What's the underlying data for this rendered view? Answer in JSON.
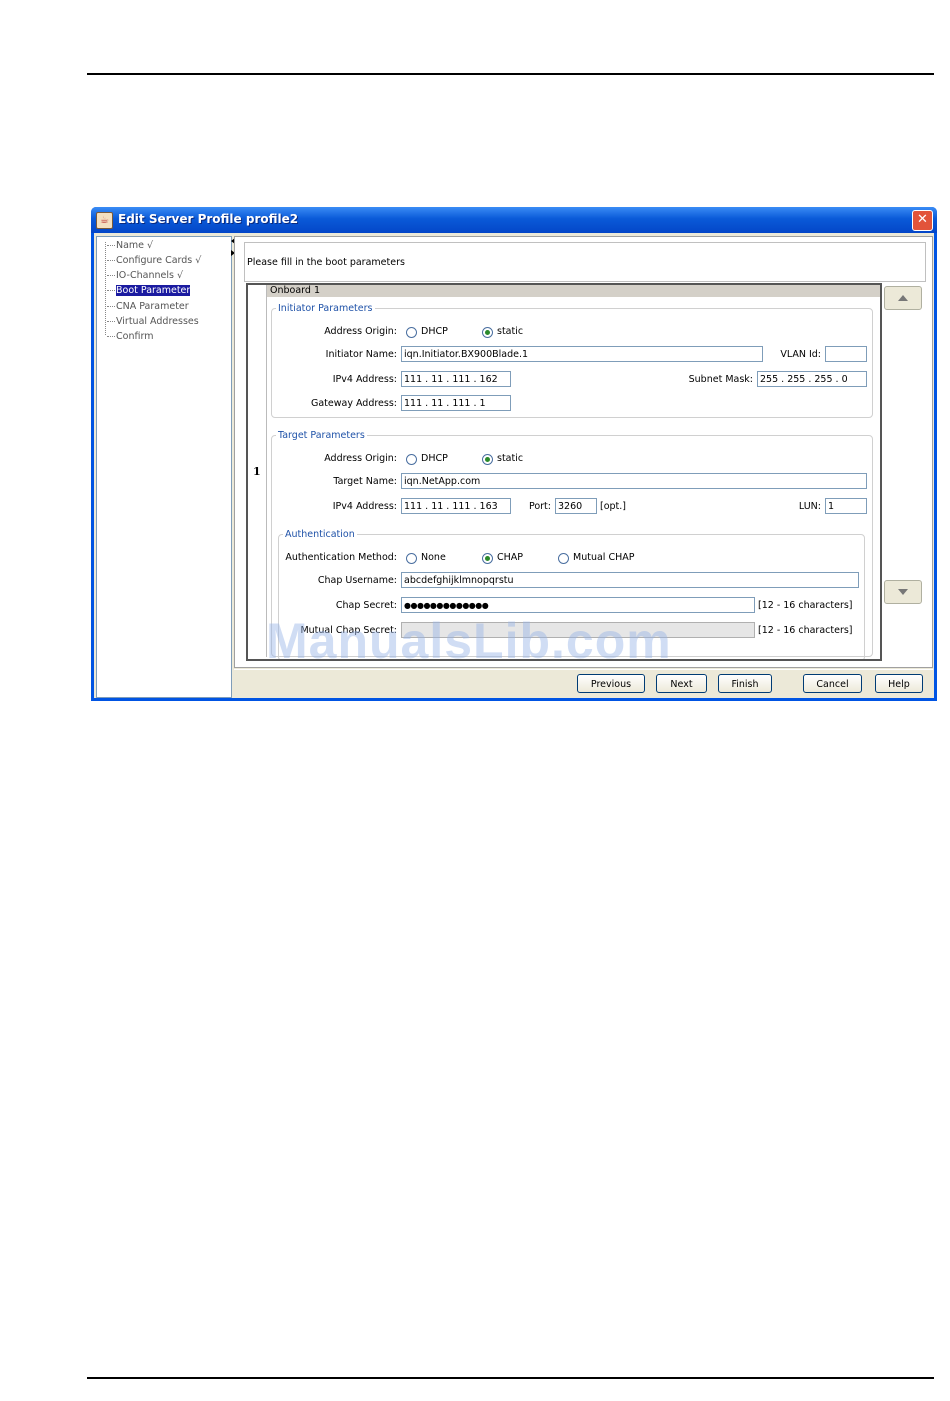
{
  "window": {
    "title": "Edit Server Profile profile2",
    "close_glyph": "✕",
    "title_icon": "java-icon"
  },
  "tree": {
    "items": [
      {
        "label": "Name √"
      },
      {
        "label": "Configure Cards √"
      },
      {
        "label": "IO-Channels √"
      },
      {
        "label": "Boot Parameter",
        "selected": true
      },
      {
        "label": "CNA Parameter"
      },
      {
        "label": "Virtual Addresses"
      },
      {
        "label": "Confirm"
      }
    ]
  },
  "main": {
    "instruction": "Please fill in the boot parameters",
    "row_number": "1",
    "onboard_header": "Onboard 1",
    "initiator": {
      "legend": "Initiator Parameters",
      "address_origin_label": "Address Origin:",
      "dhcp_label": "DHCP",
      "static_label": "static",
      "selected_origin": "static",
      "initiator_name_label": "Initiator Name:",
      "initiator_name_value": "iqn.Initiator.BX900Blade.1",
      "vlan_id_label": "VLAN Id:",
      "vlan_id_value": "",
      "ipv4_label": "IPv4 Address:",
      "ipv4_value": "111 .  11  . 111 . 162",
      "subnet_label": "Subnet Mask:",
      "subnet_value": "255 . 255 . 255 .   0",
      "gateway_label": "Gateway Address:",
      "gateway_value": "111 .  11  . 111 .   1"
    },
    "target": {
      "legend": "Target Parameters",
      "address_origin_label": "Address Origin:",
      "dhcp_label": "DHCP",
      "static_label": "static",
      "selected_origin": "static",
      "target_name_label": "Target Name:",
      "target_name_value": "iqn.NetApp.com",
      "ipv4_label": "IPv4 Address:",
      "ipv4_value": "111 .  11  . 111 . 163",
      "port_label": "Port:",
      "port_value": "3260",
      "port_opt": "[opt.]",
      "lun_label": "LUN:",
      "lun_value": "1"
    },
    "auth": {
      "legend": "Authentication",
      "method_label": "Authentication Method:",
      "none_label": "None",
      "chap_label": "CHAP",
      "mutual_chap_label": "Mutual CHAP",
      "selected_method": "CHAP",
      "chap_username_label": "Chap Username:",
      "chap_username_value": "abcdefghijklmnopqrstu",
      "chap_secret_label": "Chap Secret:",
      "chap_secret_value": "●●●●●●●●●●●●●",
      "chap_secret_hint": "[12 - 16 characters]",
      "mutual_secret_label": "Mutual Chap Secret:",
      "mutual_secret_value": "",
      "mutual_secret_hint": "[12 - 16 characters]"
    }
  },
  "buttons": {
    "previous": "Previous",
    "next": "Next",
    "finish": "Finish",
    "cancel": "Cancel",
    "help": "Help"
  },
  "watermark": "ManualsLib.com"
}
